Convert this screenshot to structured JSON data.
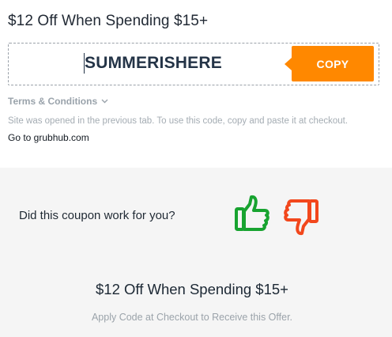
{
  "coupon": {
    "title": "$12 Off When Spending $15+",
    "code": "SUMMERISHERE",
    "copy_label": "COPY"
  },
  "terms": {
    "label": "Terms & Conditions"
  },
  "instructions": {
    "note": "Site was opened in the previous tab. To use this code, copy and paste it at checkout.",
    "goto_label": "Go to grubhub.com"
  },
  "feedback": {
    "question": "Did this coupon work for you?",
    "up_icon": "thumbs-up-icon",
    "down_icon": "thumbs-down-icon",
    "up_color": "#18a330",
    "down_color": "#f2471c"
  },
  "offer": {
    "title": "$12 Off When Spending $15+",
    "subtitle": "Apply Code at Checkout to Receive this Offer."
  },
  "colors": {
    "accent": "#ff8800",
    "panel_bg": "#f5f5f5"
  }
}
